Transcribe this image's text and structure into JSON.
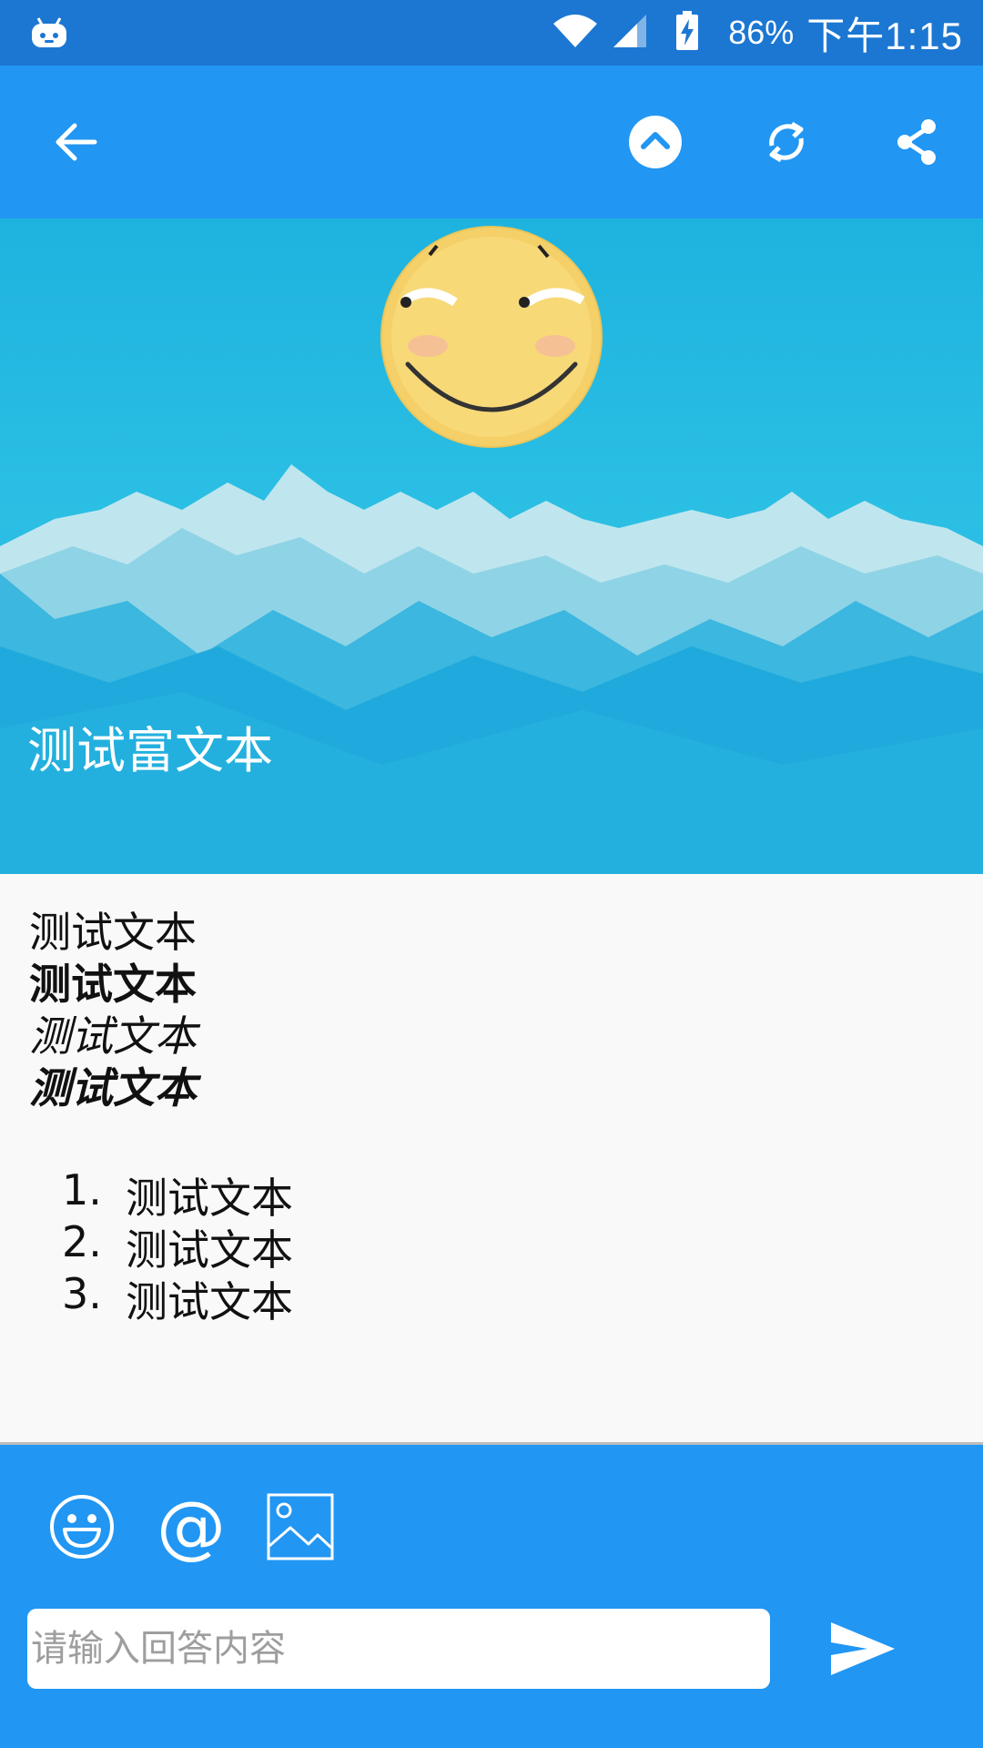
{
  "status_bar": {
    "battery_percent": "86%",
    "time": "下午1:15",
    "icons": [
      "robot-notification-icon",
      "wifi-icon",
      "signal-icon",
      "battery-charging-icon"
    ]
  },
  "toolbar": {
    "icons": [
      "arrow-back-icon",
      "chevron-up-circle-icon",
      "refresh-icon",
      "share-icon"
    ]
  },
  "hero": {
    "title": "测试富文本"
  },
  "content": {
    "lines": [
      "测试文本",
      "测试文本",
      "测试文本",
      "测试文本"
    ],
    "list": [
      {
        "num": "1.",
        "text": "测试文本"
      },
      {
        "num": "2.",
        "text": "测试文本"
      },
      {
        "num": "3.",
        "text": "测试文本"
      }
    ]
  },
  "composer": {
    "at_symbol": "@",
    "placeholder": "请输入回答内容",
    "icons": [
      "emoji-icon",
      "at-icon",
      "image-icon",
      "send-icon"
    ]
  },
  "colors": {
    "status_bar": "#1b77d2",
    "primary": "#2196f3",
    "content_bg": "#f9f9f9"
  }
}
